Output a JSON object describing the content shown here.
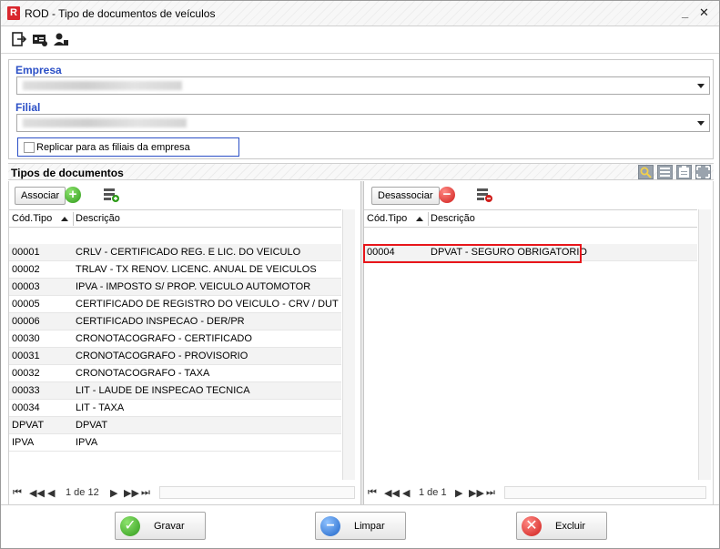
{
  "window": {
    "title": "ROD - Tipo de documentos de veículos",
    "minimize_label": "_",
    "close_label": "✕"
  },
  "filters": {
    "empresa_label": "Empresa",
    "filial_label": "Filial",
    "replicar_label": "Replicar para as filiais da empresa"
  },
  "section": {
    "title": "Tipos de documentos"
  },
  "left_panel": {
    "action_label": "Associar",
    "col_code": "Cód.Tipo",
    "col_desc": "Descrição",
    "rows": [
      {
        "code": "00001",
        "desc": "CRLV - CERTIFICADO REG. E LIC. DO VEICULO"
      },
      {
        "code": "00002",
        "desc": "TRLAV - TX RENOV. LICENC. ANUAL DE VEICULOS"
      },
      {
        "code": "00003",
        "desc": "IPVA - IMPOSTO S/ PROP. VEICULO AUTOMOTOR"
      },
      {
        "code": "00005",
        "desc": "CERTIFICADO DE REGISTRO DO VEICULO - CRV / DUT"
      },
      {
        "code": "00006",
        "desc": "CERTIFICADO INSPECAO - DER/PR"
      },
      {
        "code": "00030",
        "desc": "CRONOTACOGRAFO - CERTIFICADO"
      },
      {
        "code": "00031",
        "desc": "CRONOTACOGRAFO - PROVISORIO"
      },
      {
        "code": "00032",
        "desc": "CRONOTACOGRAFO - TAXA"
      },
      {
        "code": "00033",
        "desc": "LIT - LAUDE DE INSPECAO TECNICA"
      },
      {
        "code": "00034",
        "desc": "LIT - TAXA"
      },
      {
        "code": "DPVAT",
        "desc": "DPVAT"
      },
      {
        "code": "IPVA",
        "desc": "IPVA"
      }
    ],
    "pager": "1 de 12"
  },
  "right_panel": {
    "action_label": "Desassociar",
    "col_code": "Cód.Tipo",
    "col_desc": "Descrição",
    "rows": [
      {
        "code": "00004",
        "desc": "DPVAT - SEGURO OBRIGATORIO"
      }
    ],
    "pager": "1 de 1"
  },
  "footer": {
    "save_label": "Gravar",
    "clear_label": "Limpar",
    "delete_label": "Excluir"
  },
  "colors": {
    "label_blue": "#2b4fc6",
    "highlight_red": "#e8161b",
    "add_green": "#2f9b1a",
    "remove_red": "#cf1d1a"
  },
  "icons": [
    "exit-icon",
    "id-card-icon",
    "user-icon",
    "search-icon",
    "list-icon",
    "clipboard-icon",
    "fullscreen-icon",
    "add-icon",
    "remove-icon",
    "grid-settings-icon",
    "check-icon",
    "minus-icon",
    "close-icon"
  ]
}
